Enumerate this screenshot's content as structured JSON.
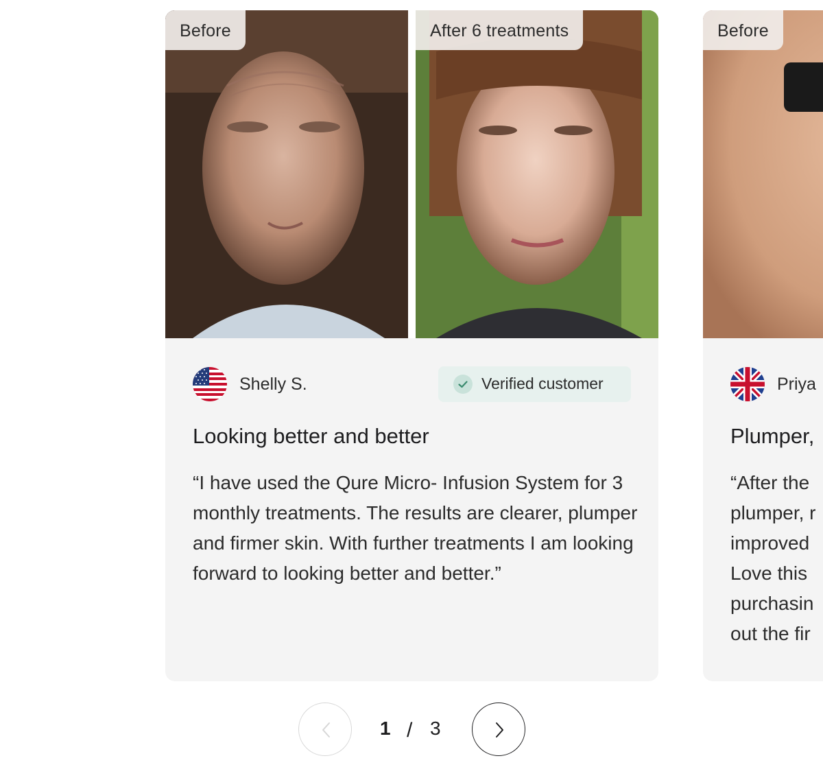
{
  "reviews": [
    {
      "before_label": "Before",
      "after_label": "After 6 treatments",
      "reviewer": "Shelly S.",
      "flag": "us-flag-icon",
      "verified_label": "Verified customer",
      "title": "Looking better and better",
      "body": "“I have used the Qure Micro- Infusion System for 3 monthly treatments. The results are clearer, plumper and firmer skin. With further treatments I am looking forward to looking better and better.”"
    },
    {
      "before_label": "Before",
      "reviewer": "Priya",
      "flag": "uk-flag-icon",
      "title": "Plumper,",
      "body": "“After the plumper, r improved Love this purchasin out the fir"
    }
  ],
  "pager": {
    "current": "1",
    "separator": "/",
    "total": "3"
  },
  "colors": {
    "card_bg": "#f4f4f4",
    "badge_bg": "#f0ece8",
    "verified_bg": "#e7f1ee",
    "verified_check": "#3a8a6e",
    "disabled_border": "#d7d7d7"
  }
}
